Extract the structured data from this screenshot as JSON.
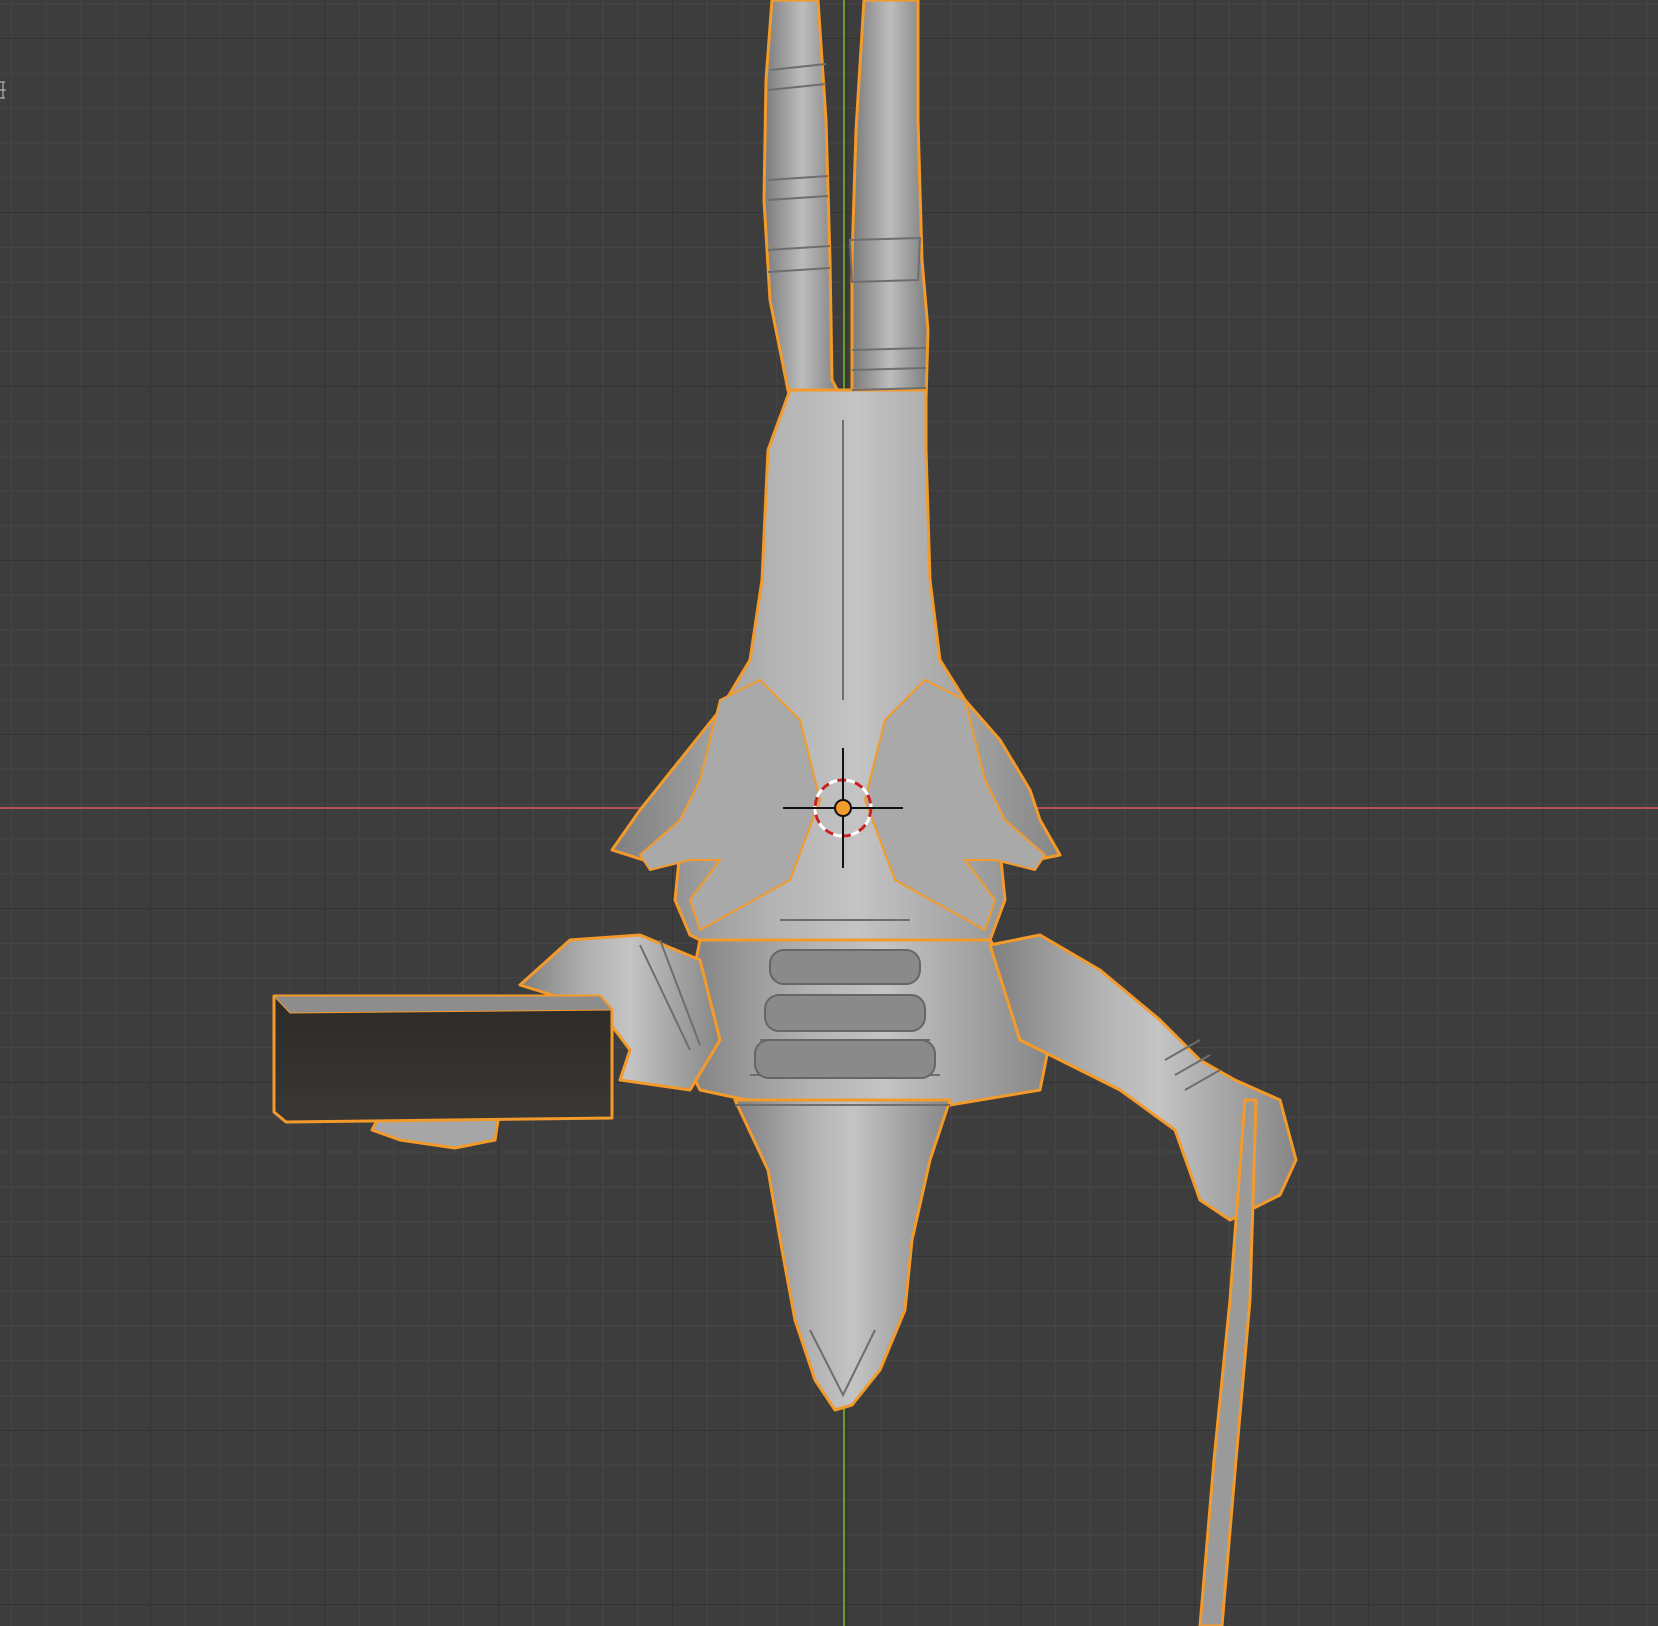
{
  "viewport": {
    "background": "#3d3d3d",
    "grid_minor": "#464646",
    "grid_major": "#333333",
    "x_axis_color": "#b64f5d",
    "y_axis_color": "#6a9a2e",
    "selection_outline": "#f39a2b",
    "mesh_color": "#9c9c9c",
    "icons": {
      "origin": "object-origin-icon",
      "cursor": "3d-cursor-icon"
    }
  }
}
